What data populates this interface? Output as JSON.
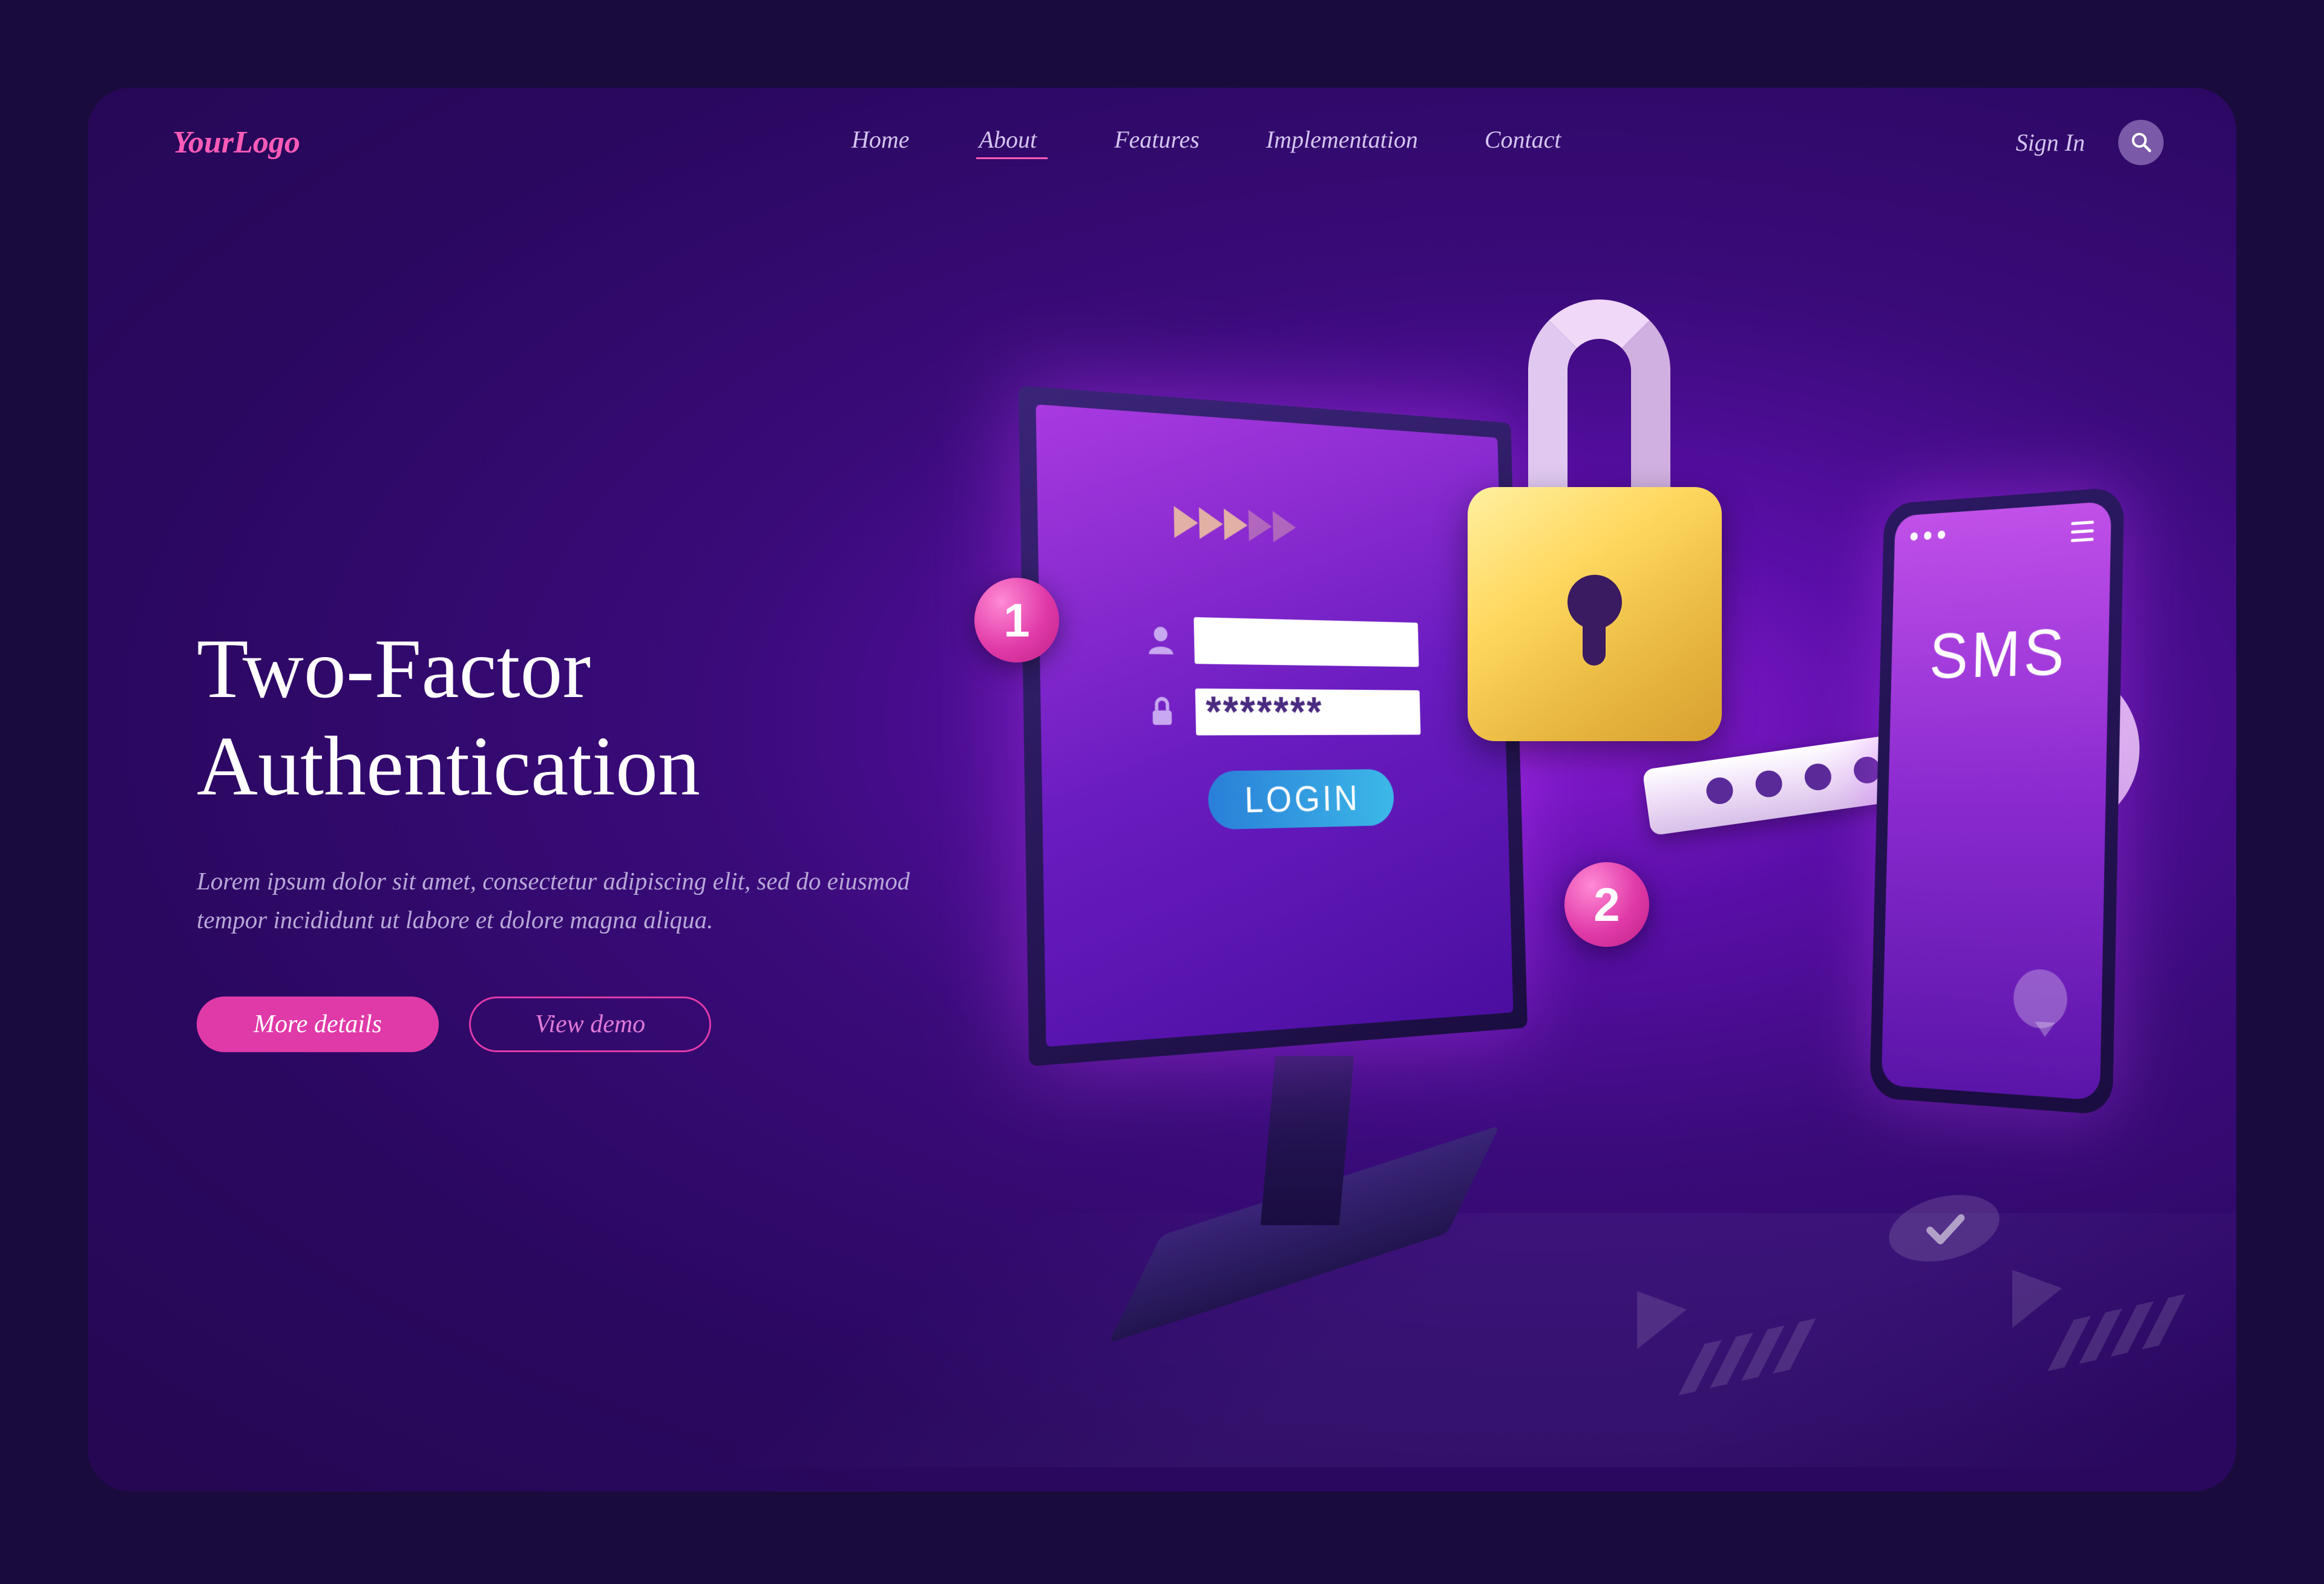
{
  "header": {
    "logo": "YourLogo",
    "nav": [
      "Home",
      "About",
      "Features",
      "Implementation",
      "Contact"
    ],
    "active_nav_index": 1,
    "signin": "Sign In"
  },
  "hero": {
    "title_line1": "Two-Factor",
    "title_line2": "Authentication",
    "description": "Lorem ipsum dolor sit amet, consectetur adipiscing elit, sed do eiusmod tempor incididunt ut labore et dolore magna aliqua.",
    "primary_btn": "More details",
    "secondary_btn": "View demo"
  },
  "illustration": {
    "badge1": "1",
    "badge2": "2",
    "password_mask": "*******",
    "login_label": "LOGIN",
    "sms_label": "SMS"
  },
  "colors": {
    "accent_pink": "#e03aa8",
    "bg_dark": "#1a0b3d",
    "bg_purple_light": "#8a1bd4"
  }
}
